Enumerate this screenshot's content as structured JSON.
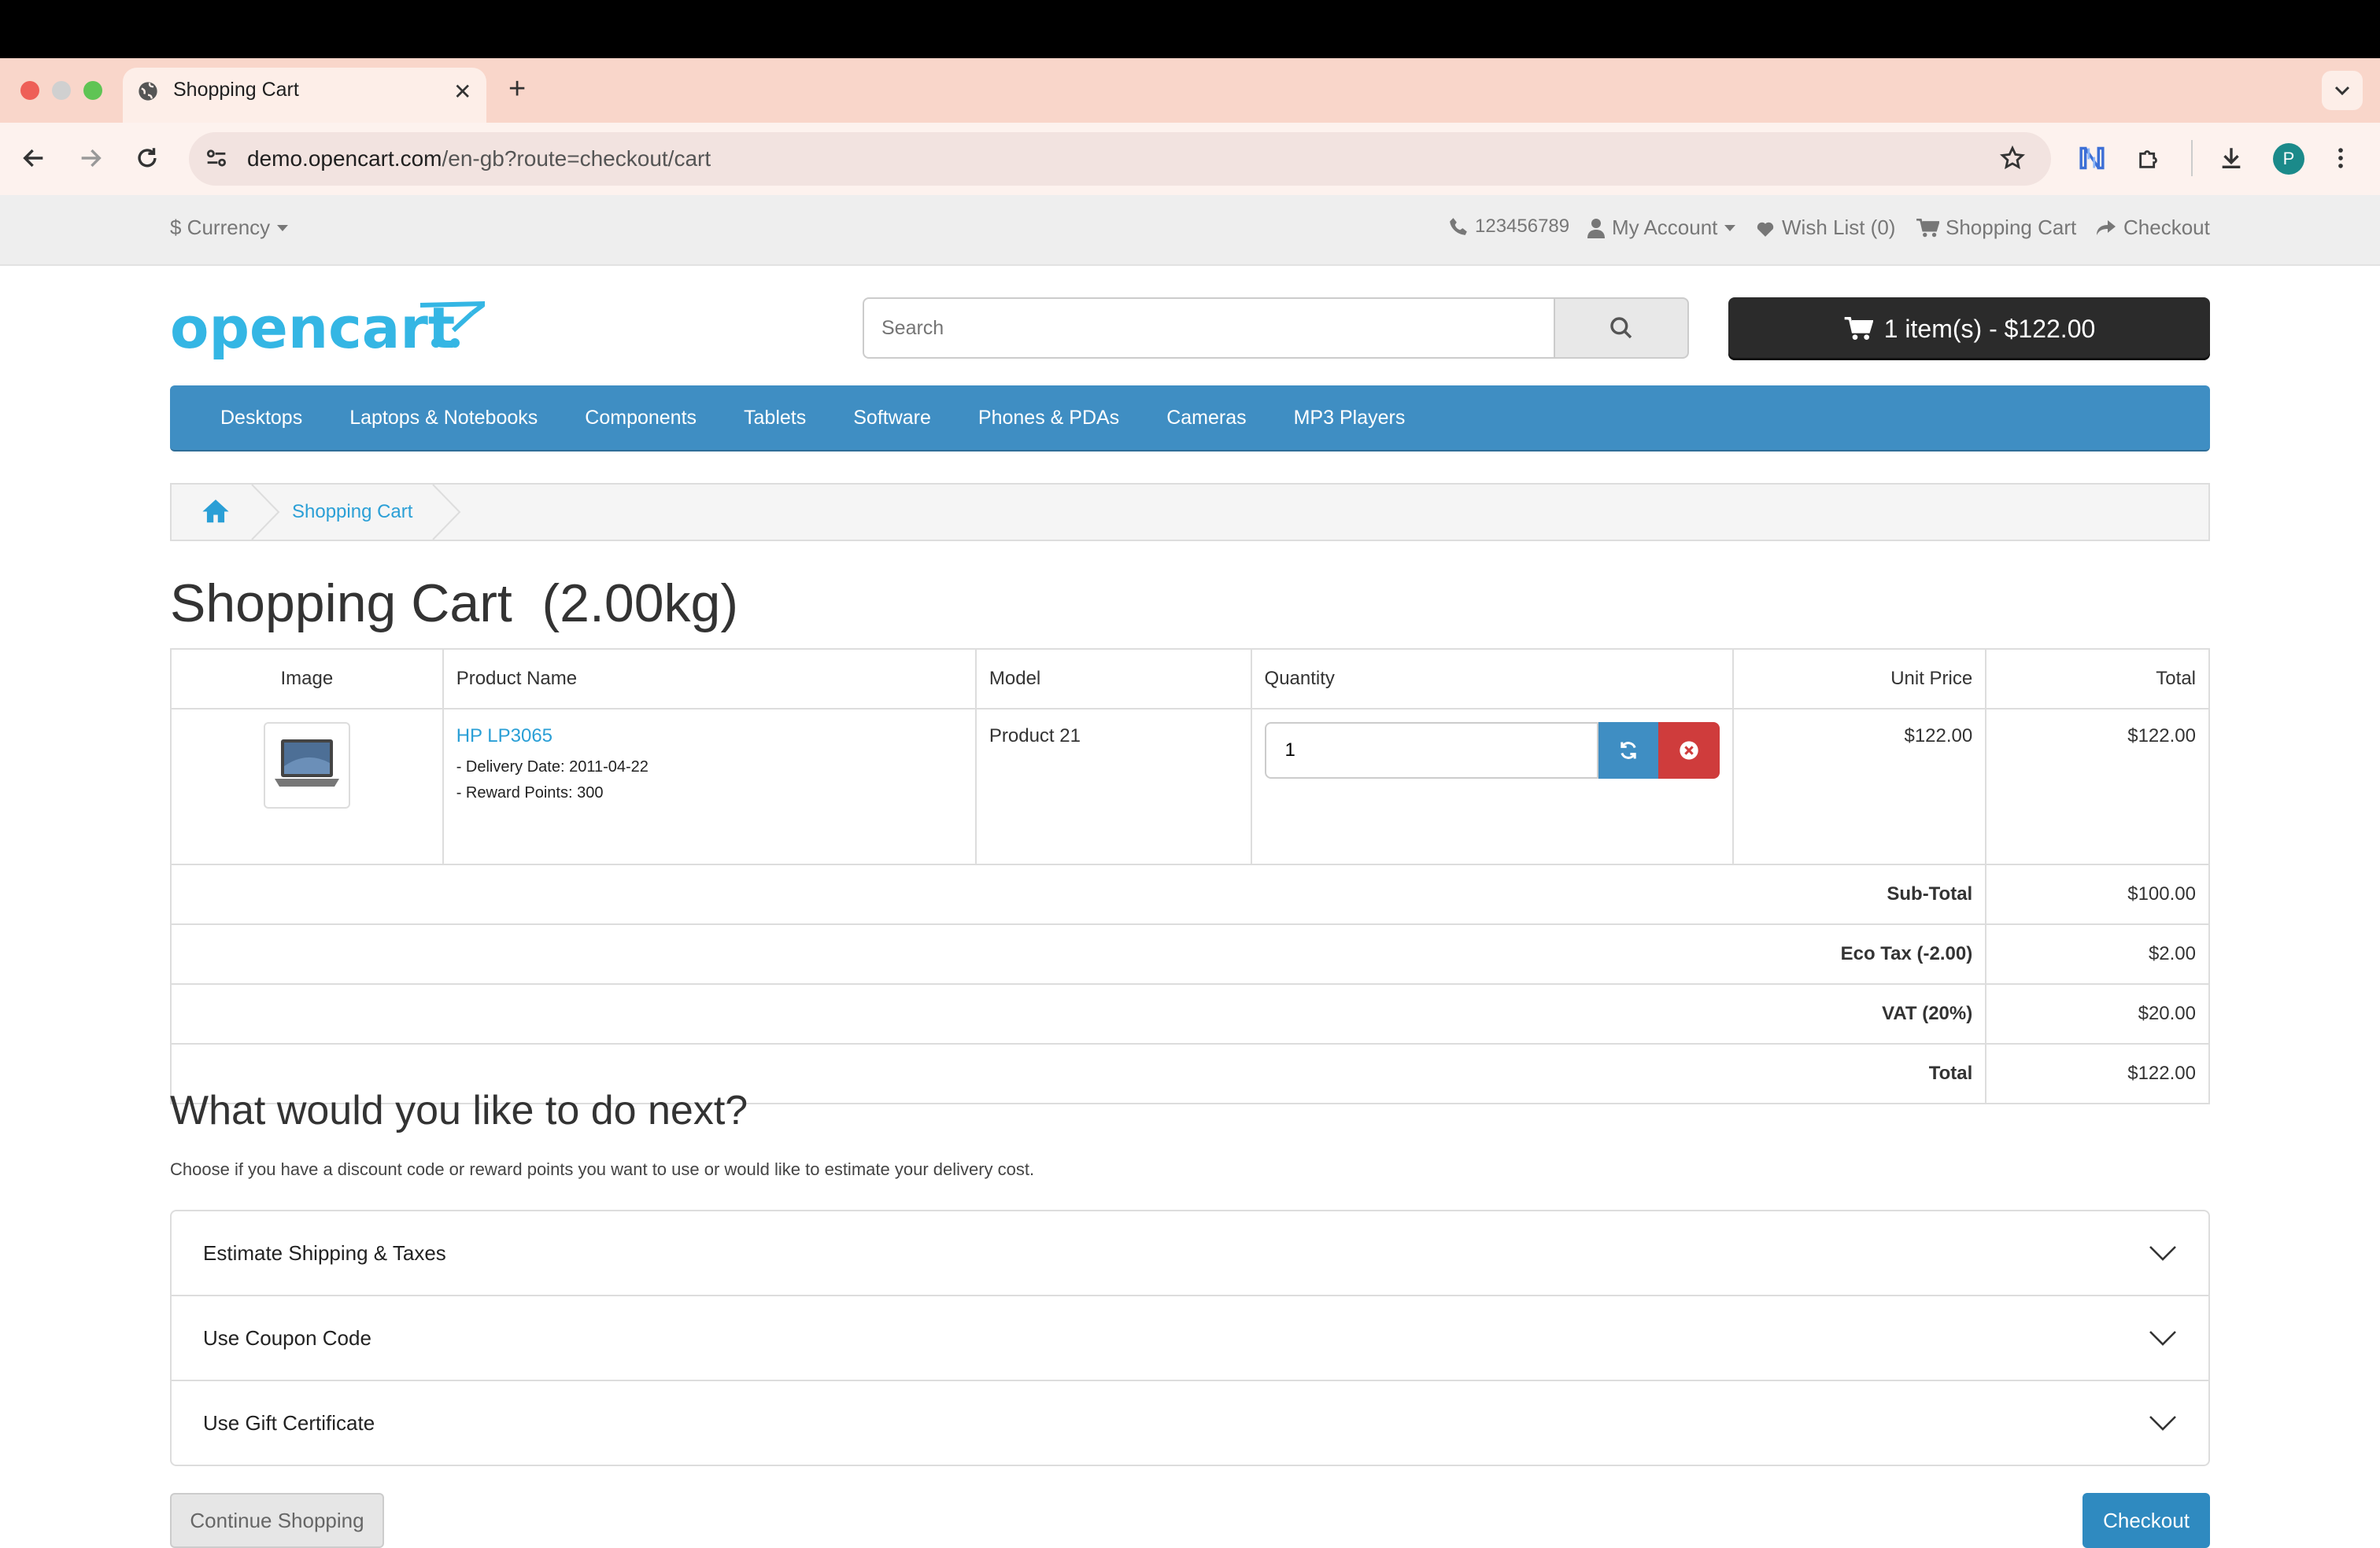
{
  "browser": {
    "tab_title": "Shopping Cart",
    "url_domain": "demo.opencart.com",
    "url_path": "/en-gb?route=checkout/cart",
    "profile_initial": "P"
  },
  "topbar": {
    "currency": "$ Currency",
    "phone": "123456789",
    "my_account": "My Account",
    "wish_list": "Wish List (0)",
    "shopping_cart": "Shopping Cart",
    "checkout": "Checkout"
  },
  "header": {
    "logo_text": "opencart",
    "search_placeholder": "Search",
    "cart_button": "1 item(s) - $122.00"
  },
  "menu": [
    "Desktops",
    "Laptops & Notebooks",
    "Components",
    "Tablets",
    "Software",
    "Phones & PDAs",
    "Cameras",
    "MP3 Players"
  ],
  "breadcrumb": {
    "current": "Shopping Cart"
  },
  "page_title": "Shopping Cart  (2.00kg)",
  "table": {
    "headers": {
      "image": "Image",
      "name": "Product Name",
      "model": "Model",
      "quantity": "Quantity",
      "unit_price": "Unit Price",
      "total": "Total"
    },
    "rows": [
      {
        "name": "HP LP3065",
        "delivery": "- Delivery Date: 2011-04-22",
        "reward": "- Reward Points: 300",
        "model": "Product 21",
        "quantity": "1",
        "unit_price": "$122.00",
        "total": "$122.00"
      }
    ],
    "totals": [
      {
        "label": "Sub-Total",
        "value": "$100.00"
      },
      {
        "label": "Eco Tax (-2.00)",
        "value": "$2.00"
      },
      {
        "label": "VAT (20%)",
        "value": "$20.00"
      },
      {
        "label": "Total",
        "value": "$122.00"
      }
    ]
  },
  "next": {
    "title": "What would you like to do next?",
    "description": "Choose if you have a discount code or reward points you want to use or would like to estimate your delivery cost.",
    "sections": [
      "Estimate Shipping & Taxes",
      "Use Coupon Code",
      "Use Gift Certificate"
    ]
  },
  "buttons": {
    "continue": "Continue Shopping",
    "checkout": "Checkout"
  },
  "colors": {
    "accent": "#3f8ec3",
    "link": "#2a9fd6",
    "danger": "#cf3c3c",
    "cart_button": "#2b2b2b",
    "tabstrip": "#f9d6ca"
  }
}
